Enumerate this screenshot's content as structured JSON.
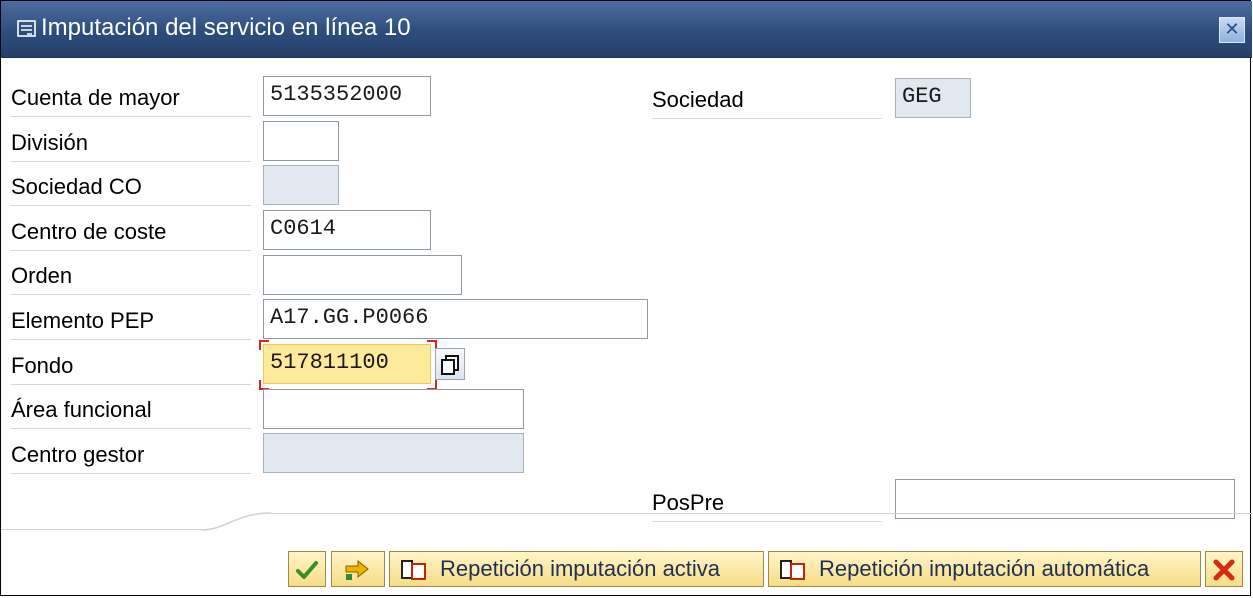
{
  "window": {
    "title": "Imputación del servicio en línea 10",
    "title_icon": "window-icon",
    "close_icon": "close-icon"
  },
  "fields": [
    {
      "label": "Cuenta de mayor",
      "value": "5135352000",
      "state": "normal"
    },
    {
      "label": "División",
      "value": "",
      "state": "normal"
    },
    {
      "label": "Sociedad CO",
      "value": "",
      "state": "disabled"
    },
    {
      "label": "Centro de coste",
      "value": "C0614",
      "state": "normal"
    },
    {
      "label": "Orden",
      "value": "",
      "state": "normal"
    },
    {
      "label": "Elemento PEP",
      "value": "A17.GG.P0066",
      "state": "normal"
    },
    {
      "label": "Fondo",
      "value": "517811100",
      "state": "focused"
    },
    {
      "label": "Área funcional",
      "value": "",
      "state": "normal"
    },
    {
      "label": "Centro gestor",
      "value": "",
      "state": "disabled"
    }
  ],
  "right_fields": [
    {
      "label": "Sociedad",
      "value": "GEG",
      "state": "readonly"
    },
    {
      "label": "PosPre",
      "value": "",
      "state": "normal"
    }
  ],
  "toolbar": {
    "continue_icon": "checkmark-icon",
    "next_icon": "arrow-right-icon",
    "repeat_active_label": "Repetición imputación activa",
    "repeat_auto_label": "Repetición imputación automática",
    "cancel_icon": "cancel-icon"
  },
  "colors": {
    "titlebar": "#2e4d7c",
    "focus_field": "#ffe99a",
    "button": "#f6dd86",
    "disabled_field": "#e2e8ef"
  }
}
